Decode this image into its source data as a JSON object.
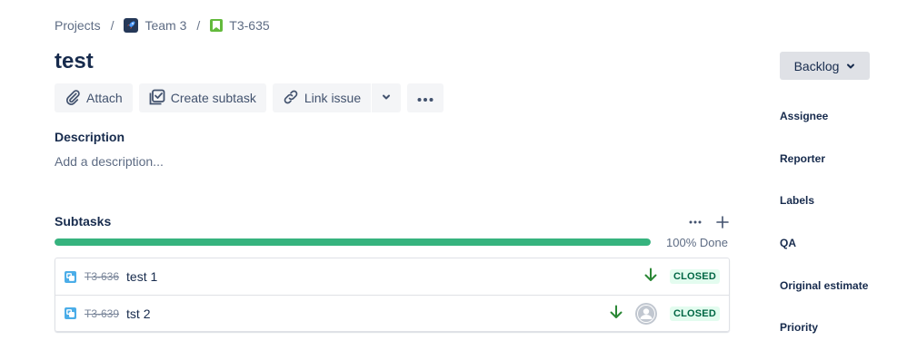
{
  "breadcrumb": {
    "projects": "Projects",
    "separator": "/",
    "project_name": "Team 3",
    "issue_key": "T3-635"
  },
  "issue": {
    "title": "test"
  },
  "toolbar": {
    "attach": "Attach",
    "create_subtask": "Create subtask",
    "link_issue": "Link issue"
  },
  "description": {
    "label": "Description",
    "placeholder": "Add a description..."
  },
  "subtasks": {
    "label": "Subtasks",
    "progress_fraction": 1.0,
    "progress_text": "100% Done",
    "items": [
      {
        "key": "T3-636",
        "summary": "test 1",
        "priority": "low-priority-icon",
        "has_assignee_avatar": false,
        "status": "CLOSED"
      },
      {
        "key": "T3-639",
        "summary": "tst 2",
        "priority": "low-priority-icon",
        "has_assignee_avatar": true,
        "status": "CLOSED"
      }
    ]
  },
  "sidebar": {
    "status_button": "Backlog",
    "fields": [
      "Assignee",
      "Reporter",
      "Labels",
      "QA",
      "Original estimate",
      "Priority"
    ]
  },
  "colors": {
    "progress": "#36b37e",
    "closed_lozenge_bg": "#e3fcef",
    "closed_lozenge_text": "#006644",
    "priority_low": "#2a8735",
    "subtask_icon": "#4bade8",
    "story_icon": "#63ba3c"
  }
}
